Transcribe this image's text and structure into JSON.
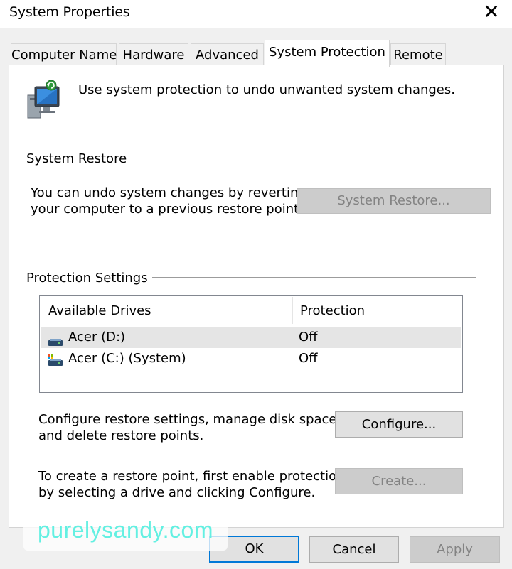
{
  "window": {
    "title": "System Properties",
    "close_glyph": "✕"
  },
  "tabs": [
    {
      "label": "Computer Name"
    },
    {
      "label": "Hardware"
    },
    {
      "label": "Advanced"
    },
    {
      "label": "System Protection",
      "active": true
    },
    {
      "label": "Remote"
    }
  ],
  "intro": {
    "text": "Use system protection to undo unwanted system changes."
  },
  "system_restore": {
    "group_label": "System Restore",
    "desc_line1": "You can undo system changes by reverting",
    "desc_line2": "your computer to a previous restore point.",
    "button_label": "System Restore..."
  },
  "protection_settings": {
    "group_label": "Protection Settings",
    "columns": [
      "Available Drives",
      "Protection"
    ],
    "drives": [
      {
        "name": "Acer (D:)",
        "protection": "Off",
        "selected": true
      },
      {
        "name": "Acer (C:) (System)",
        "protection": "Off",
        "selected": false
      }
    ],
    "configure_desc_line1": "Configure restore settings, manage disk space,",
    "configure_desc_line2": "and delete restore points.",
    "configure_label": "Configure...",
    "create_desc_line1": "To create a restore point, first enable protection",
    "create_desc_line2": "by selecting a drive and clicking Configure.",
    "create_label": "Create..."
  },
  "footer": {
    "ok_label": "OK",
    "cancel_label": "Cancel",
    "apply_label": "Apply"
  },
  "watermark": {
    "text": "purelysandy.com"
  },
  "colors": {
    "accent": "#0078d7",
    "disabled_button": "#cccccc",
    "selection": "#e5e5e5"
  }
}
